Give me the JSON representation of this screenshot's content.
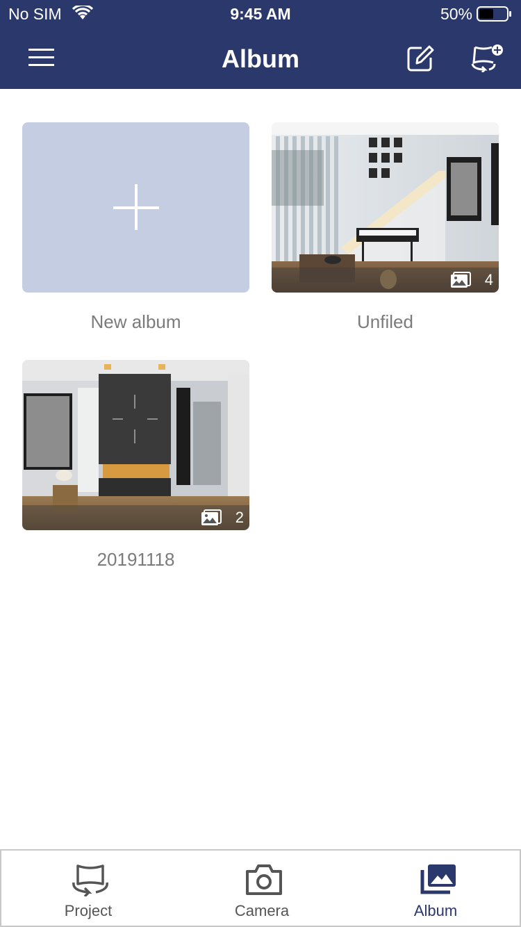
{
  "status_bar": {
    "carrier": "No SIM",
    "time": "9:45 AM",
    "battery": "50%"
  },
  "nav": {
    "title": "Album",
    "menu_icon": "hamburger-menu-icon",
    "edit_icon": "edit-pencil-icon",
    "add_icon": "add-scene-icon"
  },
  "albums": [
    {
      "label": "New album",
      "type": "new"
    },
    {
      "label": "Unfiled",
      "count": "4",
      "type": "photo"
    },
    {
      "label": "20191118",
      "count": "2",
      "type": "photo"
    }
  ],
  "tabs": [
    {
      "label": "Project",
      "icon": "project-icon",
      "active": false
    },
    {
      "label": "Camera",
      "icon": "camera-icon",
      "active": false
    },
    {
      "label": "Album",
      "icon": "album-icon",
      "active": true
    }
  ],
  "colors": {
    "header": "#2b386b",
    "new_tile": "#c5cde2",
    "caption": "#7b7b7b",
    "active_tab": "#2b386b"
  }
}
